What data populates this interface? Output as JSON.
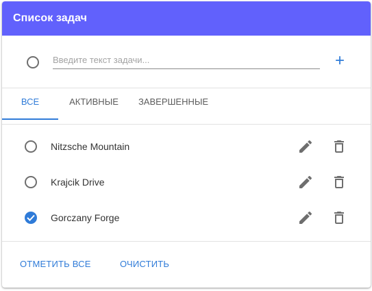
{
  "header": {
    "title": "Список задач"
  },
  "new_task": {
    "placeholder": "Введите текст задачи...",
    "add_label": "+"
  },
  "tabs": [
    {
      "label": "ВСЕ",
      "active": true
    },
    {
      "label": "АКТИВНЫЕ",
      "active": false
    },
    {
      "label": "ЗАВЕРШЕННЫЕ",
      "active": false
    }
  ],
  "tasks": [
    {
      "label": "Nitzsche Mountain",
      "done": false
    },
    {
      "label": "Krajcik Drive",
      "done": false
    },
    {
      "label": "Gorczany Forge",
      "done": true
    }
  ],
  "footer": {
    "mark_all_label": "ОТМЕТИТЬ ВСЕ",
    "clear_label": "ОЧИСТИТЬ"
  },
  "colors": {
    "header": "#6161fc",
    "accent": "#2f7bd8",
    "icon": "#6e6e6e"
  },
  "icons": {
    "edit": "pencil-icon",
    "delete": "trash-icon",
    "add": "plus-icon"
  }
}
